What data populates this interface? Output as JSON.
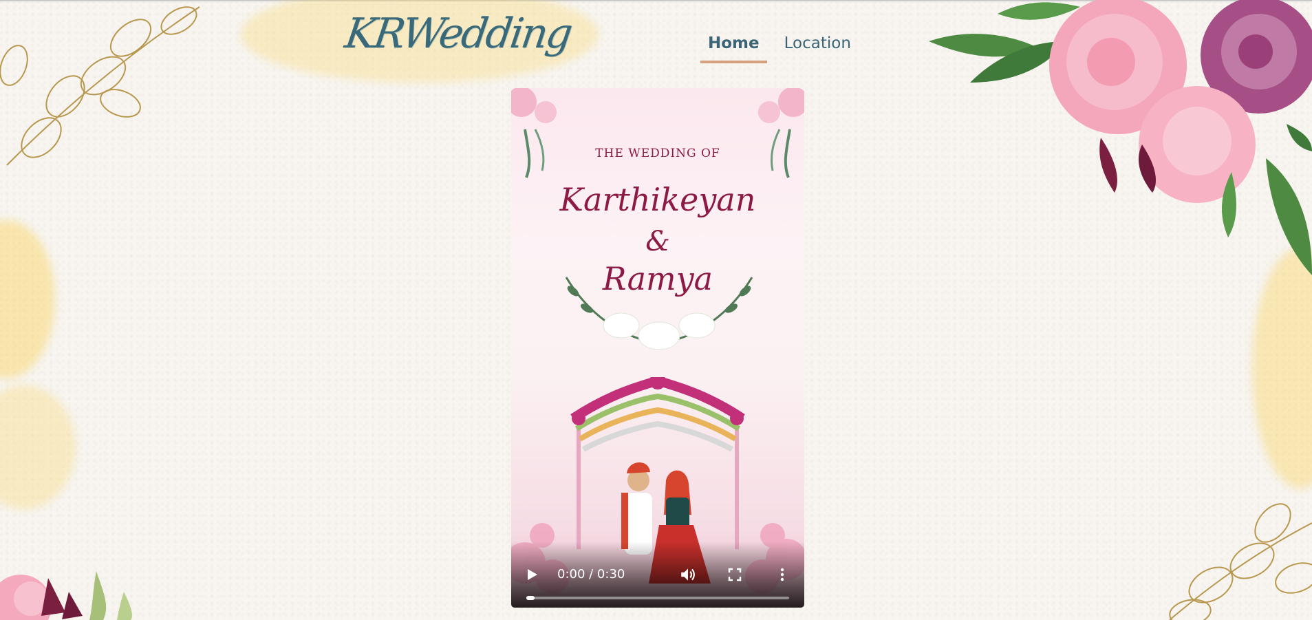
{
  "brand": {
    "logo_text": "KRWedding"
  },
  "nav": {
    "items": [
      {
        "label": "Home",
        "active": true
      },
      {
        "label": "Location",
        "active": false
      }
    ]
  },
  "video": {
    "eyebrow": "THE WEDDING OF",
    "name_one": "Karthikeyan",
    "ampersand": "&",
    "name_two": "Ramya",
    "time_display": "0:00 / 0:30",
    "progress_fraction": 0,
    "icons": {
      "play": "play-icon",
      "volume": "volume-icon",
      "fullscreen": "fullscreen-icon",
      "more": "more-vertical-icon"
    }
  },
  "colors": {
    "accent_teal": "#386a7c",
    "nav_underline": "#d4a07d",
    "title_magenta": "#8c1a45"
  }
}
